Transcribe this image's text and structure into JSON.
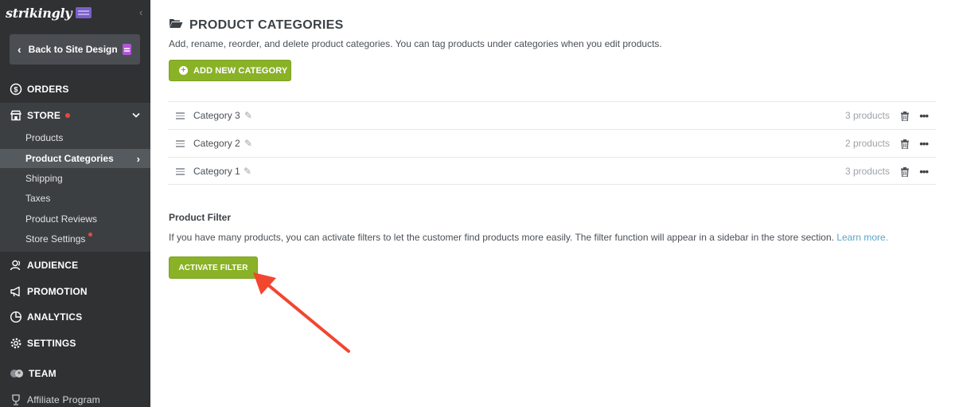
{
  "sidebar": {
    "brand": "strikingly",
    "back_label": "Back to Site Design",
    "nav": {
      "orders": "ORDERS",
      "store": "STORE",
      "audience": "AUDIENCE",
      "promotion": "PROMOTION",
      "analytics": "ANALYTICS",
      "settings": "SETTINGS",
      "team": "TEAM",
      "affiliate": "Affiliate Program"
    },
    "store_items": [
      "Products",
      "Product Categories",
      "Shipping",
      "Taxes",
      "Product Reviews",
      "Store Settings"
    ],
    "active_item": "Product Categories"
  },
  "main": {
    "title": "PRODUCT CATEGORIES",
    "subtitle": "Add, rename, reorder, and delete product categories. You can tag products under categories when you edit products.",
    "add_button": "ADD NEW CATEGORY",
    "categories": [
      {
        "name": "Category 3",
        "count": "3 products"
      },
      {
        "name": "Category 2",
        "count": "2 products"
      },
      {
        "name": "Category 1",
        "count": "3 products"
      }
    ],
    "filter": {
      "title": "Product Filter",
      "description": "If you have many products, you can activate filters to let the customer find products more easily. The filter function will appear in a sidebar in the store section.",
      "learn_more": "Learn more.",
      "button": "ACTIVATE FILTER"
    }
  },
  "colors": {
    "sidebar_bg": "#2f3133",
    "accent_green": "#8ab227",
    "annotation_arrow": "#f2462f",
    "link": "#5ba4c9"
  }
}
